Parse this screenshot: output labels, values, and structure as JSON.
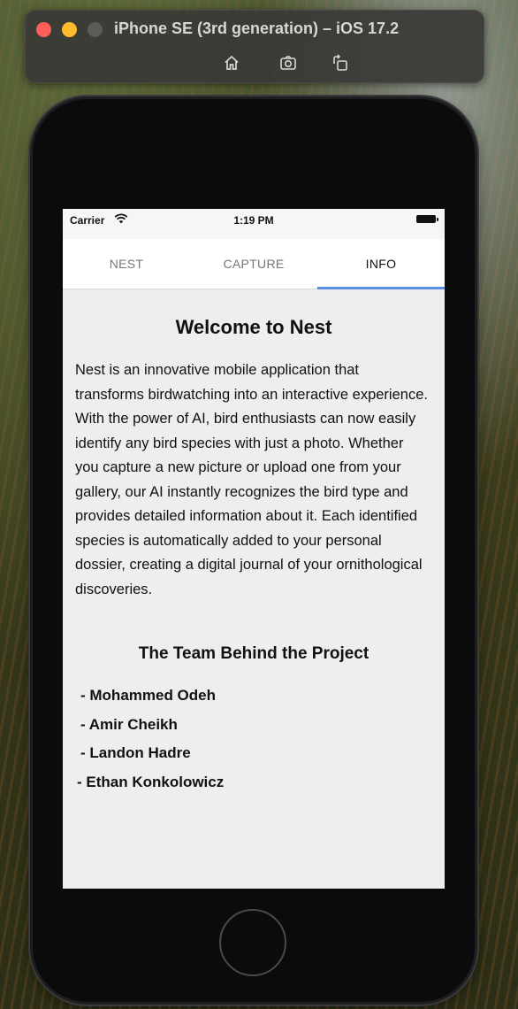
{
  "window": {
    "title": "iPhone SE (3rd generation) – iOS 17.2",
    "toolbar": [
      {
        "icon": "home-icon"
      },
      {
        "icon": "screenshot-icon"
      },
      {
        "icon": "rotate-icon"
      }
    ]
  },
  "status_bar": {
    "carrier": "Carrier",
    "time": "1:19 PM"
  },
  "tabs": [
    {
      "label": "NEST",
      "active": false
    },
    {
      "label": "CAPTURE",
      "active": false
    },
    {
      "label": "INFO",
      "active": true
    }
  ],
  "info": {
    "title": "Welcome to Nest",
    "description": "Nest is an innovative mobile application that transforms birdwatching into an interactive experience. With the power of AI, bird enthusiasts can now easily identify any bird species with just a photo. Whether you capture a new picture or upload one from your gallery, our AI instantly recognizes the bird type and provides detailed information about it. Each identified species is automatically added to your personal dossier, creating a digital journal of your ornithological discoveries.",
    "team_title": "The Team Behind the Project",
    "team": [
      "- Mohammed Odeh",
      "- Amir Cheikh",
      "- Landon Hadre",
      "- Ethan Konkolowicz"
    ]
  },
  "colors": {
    "accent": "#5b8fe6",
    "content_bg": "#eeeeee",
    "tab_bg": "#ffffff"
  }
}
